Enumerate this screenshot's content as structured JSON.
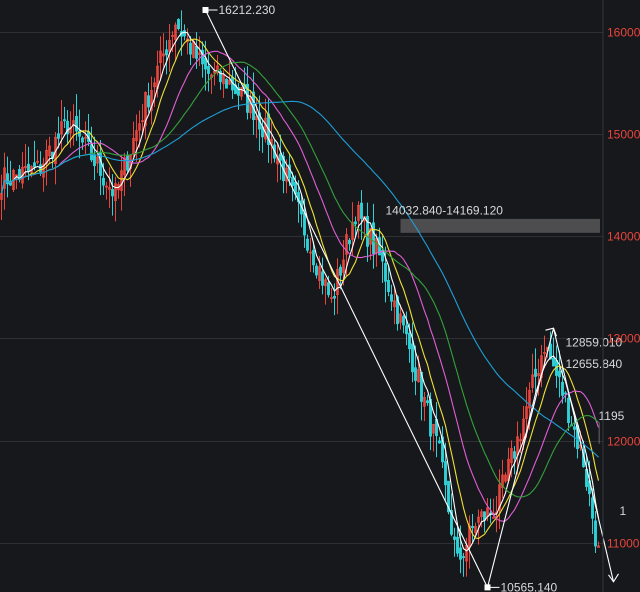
{
  "chart_data": {
    "type": "candlestick",
    "ylim": [
      10520,
      16310
    ],
    "y_ticks": [
      {
        "value": 16000,
        "label": "16000"
      },
      {
        "value": 15000,
        "label": "15000"
      },
      {
        "value": 14000,
        "label": "14000"
      },
      {
        "value": 13000,
        "label": "13000"
      },
      {
        "value": 12000,
        "label": "12000"
      },
      {
        "value": 11000,
        "label": "11000"
      }
    ],
    "grid": true,
    "bar_count": 200,
    "price_path": [
      [
        0,
        14550
      ],
      [
        12,
        14650
      ],
      [
        22,
        15100
      ],
      [
        30,
        14780
      ],
      [
        38,
        14400
      ],
      [
        48,
        15300
      ],
      [
        58,
        16100
      ],
      [
        62,
        15900
      ],
      [
        68,
        15600
      ],
      [
        76,
        15500
      ],
      [
        84,
        15250
      ],
      [
        92,
        14800
      ],
      [
        100,
        14150
      ],
      [
        110,
        13350
      ],
      [
        118,
        14250
      ],
      [
        126,
        13800
      ],
      [
        136,
        12900
      ],
      [
        146,
        11850
      ],
      [
        152,
        10800
      ],
      [
        158,
        11200
      ],
      [
        165,
        11350
      ],
      [
        172,
        12000
      ],
      [
        181,
        12950
      ],
      [
        188,
        12400
      ],
      [
        194,
        11800
      ],
      [
        199,
        10900
      ]
    ],
    "moving_averages": [
      {
        "period": 5,
        "color": "#ffffff"
      },
      {
        "period": 10,
        "color": "#f2e233"
      },
      {
        "period": 20,
        "color": "#e15ed6"
      },
      {
        "period": 30,
        "color": "#35a13b"
      },
      {
        "period": 60,
        "color": "#1e9fd6"
      }
    ],
    "zigzag_line": [
      {
        "bar": 68,
        "price": 16212.23
      },
      {
        "bar": 162,
        "price": 10565.14
      },
      {
        "bar": 184,
        "price": 13100
      },
      {
        "bar": 204,
        "price": 10620
      }
    ],
    "annotations": [
      {
        "label": "16212.230",
        "bar": 68,
        "price": 16212.23,
        "marker": true
      },
      {
        "label": "10565.140",
        "bar": 162,
        "price": 10565.14,
        "marker": true
      },
      {
        "label": "12859.010",
        "bar": 188,
        "price": 12960
      },
      {
        "label": "12655.840",
        "bar": 188,
        "price": 12750
      },
      {
        "label": "14032.840-14169.120",
        "bar": 128,
        "price": 14250
      },
      {
        "label": "1195",
        "bar": 199,
        "price": 12240
      },
      {
        "label": "1",
        "bar": 206,
        "price": 11310
      }
    ],
    "zones": [
      {
        "from_bar": 133,
        "low": 14032.84,
        "high": 14169.12,
        "color": "#7a7a7a"
      },
      {
        "from_bar": 199,
        "low": 11970,
        "high": 12180,
        "color": "#7a7a7a"
      }
    ],
    "colors": {
      "background": "#17181c",
      "up": "#e8453c",
      "down": "#2fd1d6",
      "tick_label": "#e8453c",
      "annotation": "#d8d8d8",
      "zigzag": "#ffffff"
    }
  }
}
